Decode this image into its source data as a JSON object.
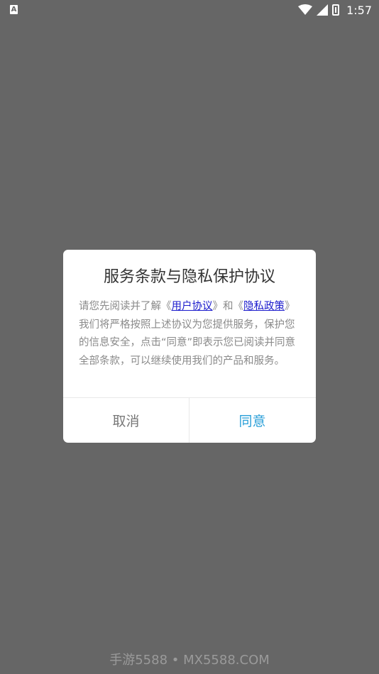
{
  "status_bar": {
    "left_icon_letter": "A",
    "time": "1:57"
  },
  "dialog": {
    "title": "服务条款与隐私保护协议",
    "body_text_1": "请您先阅读并了解《",
    "link_user_agreement": "用户协议",
    "body_text_2": "》和《",
    "link_privacy_policy": "隐私政策",
    "body_text_3": "》我们将严格按照上述协议为您提供服务，保护您的信息安全，点击“同意”即表示您已阅读并同意全部条款，可以继续使用我们的产品和服务。",
    "cancel_label": "取消",
    "agree_label": "同意"
  },
  "watermark": "手游5588 • MX5588.COM",
  "colors": {
    "overlay": "#666666",
    "link": "#1a1acc",
    "agree": "#2a9fd8"
  }
}
